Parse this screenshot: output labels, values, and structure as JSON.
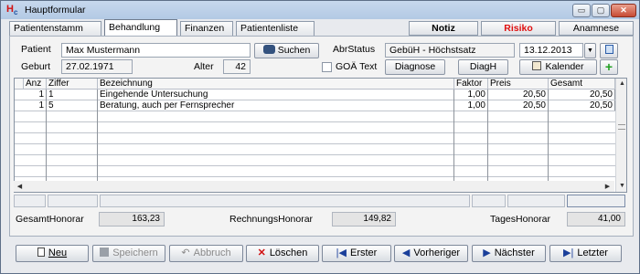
{
  "window": {
    "title": "Hauptformular",
    "logo": "H",
    "logo_sub": "c",
    "min_glyph": "▭",
    "max_glyph": "▢",
    "close_glyph": "✕"
  },
  "tabs": [
    {
      "label": "Patientenstamm"
    },
    {
      "label": "Behandlung"
    },
    {
      "label": "Finanzen"
    },
    {
      "label": "Patientenliste"
    }
  ],
  "top_buttons": {
    "notiz": "Notiz",
    "risiko": "Risiko",
    "anamnese": "Anamnese"
  },
  "patient": {
    "patient_label": "Patient",
    "name": "Max Mustermann",
    "geburt_label": "Geburt",
    "geburt": "27.02.1971",
    "alter_label": "Alter",
    "alter": "42",
    "suchen_label": "Suchen",
    "goae_label": "GOÄ Text",
    "abrstatus_label": "AbrStatus",
    "abrstatus": "GebüH - Höchstsatz",
    "datum": "13.12.2013",
    "diagnose_label": "Diagnose",
    "diagh_label": "DiagH",
    "kalender_label": "Kalender"
  },
  "grid": {
    "headers": [
      "Anz",
      "Ziffer",
      "Bezeichnung",
      "Faktor",
      "Preis",
      "Gesamt"
    ],
    "rows": [
      {
        "anz": "1",
        "ziffer": "1",
        "bezeichnung": "Eingehende Untersuchung",
        "faktor": "1,00",
        "preis": "20,50",
        "gesamt": "20,50"
      },
      {
        "anz": "1",
        "ziffer": "5",
        "bezeichnung": "Beratung, auch per Fernsprecher",
        "faktor": "1,00",
        "preis": "20,50",
        "gesamt": "20,50"
      }
    ]
  },
  "totals": {
    "gesamt_label": "GesamtHonorar",
    "gesamt_value": "163,23",
    "rechnung_label": "RechnungsHonorar",
    "rechnung_value": "149,82",
    "tages_label": "TagesHonorar",
    "tages_value": "41,00"
  },
  "nav": {
    "neu": "Neu",
    "speichern": "Speichern",
    "abbruch": "Abbruch",
    "loeschen": "Löschen",
    "erster": "Erster",
    "vorheriger": "Vorheriger",
    "naechster": "Nächster",
    "letzter": "Letzter"
  },
  "colors": {
    "risiko": "#e01010",
    "loeschen_icon": "#d01010",
    "nav_icon": "#1a3f9a",
    "add_icon": "#22a022"
  }
}
